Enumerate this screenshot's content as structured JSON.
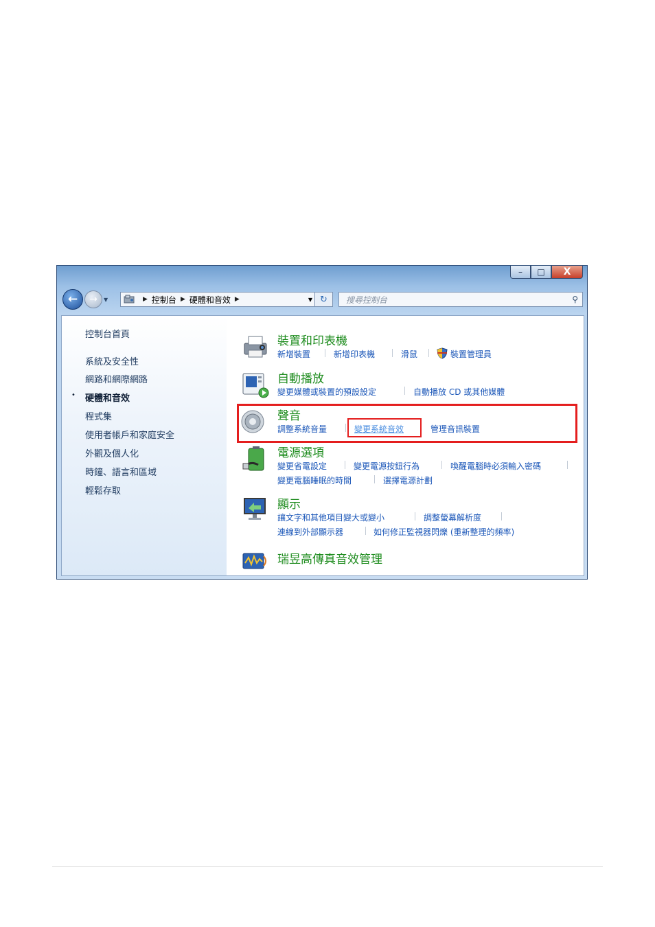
{
  "window": {
    "minimize": "–",
    "maximize": "□",
    "close": "X"
  },
  "navigation": {
    "back": "←",
    "forward": "→"
  },
  "address": {
    "crumbs": [
      "控制台",
      "硬體和音效"
    ]
  },
  "search": {
    "placeholder": "搜尋控制台"
  },
  "sidebar": {
    "items": [
      {
        "label": "控制台首頁"
      },
      {
        "label": "系統及安全性"
      },
      {
        "label": "網路和網際網路"
      },
      {
        "label": "硬體和音效",
        "active": true
      },
      {
        "label": "程式集"
      },
      {
        "label": "使用者帳戶和家庭安全"
      },
      {
        "label": "外觀及個人化"
      },
      {
        "label": "時鐘、語言和區域"
      },
      {
        "label": "輕鬆存取"
      }
    ],
    "bullet": "•"
  },
  "main": {
    "devices": {
      "title": "裝置和印表機",
      "links": [
        "新增裝置",
        "新增印表機",
        "滑鼠",
        "裝置管理員"
      ],
      "icon": "printer-icon"
    },
    "autoplay": {
      "title": "自動播放",
      "links": [
        "變更媒體或裝置的預設設定",
        "自動播放 CD 或其他媒體"
      ],
      "icon": "autoplay-icon"
    },
    "sound": {
      "title": "聲音",
      "links": [
        "調整系統音量",
        "變更系統音效",
        "管理音訊裝置"
      ],
      "icon": "speaker-icon"
    },
    "power": {
      "title": "電源選項",
      "links": [
        "變更省電設定",
        "變更電源按鈕行為",
        "喚醒電腦時必須輸入密碼",
        "變更電腦睡眠的時間",
        "選擇電源計劃"
      ],
      "icon": "battery-icon"
    },
    "display": {
      "title": "顯示",
      "links": [
        "讓文字和其他項目變大或變小",
        "調整螢幕解析度",
        "連線到外部顯示器",
        "如何修正監視器閃爍 (重新整理的頻率)"
      ],
      "icon": "monitor-icon"
    },
    "realtek": {
      "title": "瑞昱高傳真音效管理",
      "icon": "realtek-audio-icon"
    }
  },
  "colors": {
    "category": "#1e8c1e",
    "link": "#1a56b8",
    "highlight": "#e41e1e"
  }
}
